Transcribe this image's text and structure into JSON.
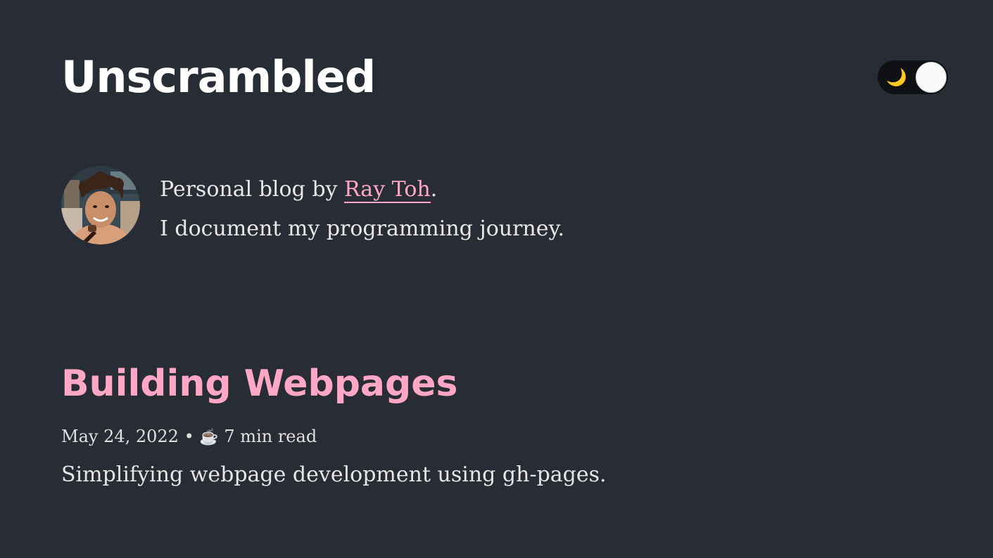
{
  "header": {
    "site_title": "Unscrambled",
    "theme_toggle": {
      "icon": "moon-icon",
      "glyph": "🌙",
      "state": "dark"
    }
  },
  "bio": {
    "prefix": "Personal blog by ",
    "author_name": "Ray Toh",
    "suffix": ".",
    "tagline": "I document my programming journey."
  },
  "posts": [
    {
      "title": "Building Webpages",
      "date": "May 24, 2022",
      "separator": " • ",
      "read_icon": "☕️",
      "read_time": " 7 min read",
      "excerpt": "Simplifying webpage development using gh-pages."
    }
  ],
  "colors": {
    "background": "#282c35",
    "accent": "#ffa7c4",
    "title": "#ffffff",
    "toggle_track": "#0f1114",
    "moon": "#ffd54a"
  }
}
